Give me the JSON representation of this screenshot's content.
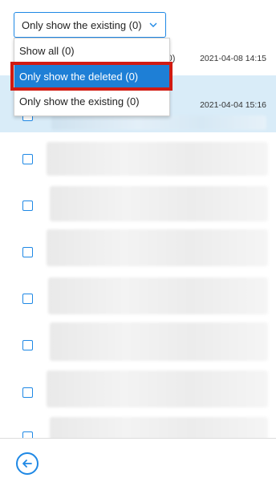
{
  "filter": {
    "selected_value": "Only show the existing (0)",
    "options": [
      "Show all (0)",
      "Only show the deleted (0)",
      "Only show the existing (0)"
    ],
    "highlighted_option": "Only show the deleted (0)"
  },
  "list": {
    "header_partial": "(0)",
    "timestamps": [
      "2021-04-08 14:15",
      "2021-04-04 15:16"
    ]
  },
  "colors": {
    "accent": "#1e88e5",
    "selected_row": "#d9ecf8",
    "active_option": "#1e7fd6",
    "highlight_box": "#d11b12"
  },
  "icons": {
    "select": "chevron-down-icon",
    "back": "back-arrow-icon"
  }
}
